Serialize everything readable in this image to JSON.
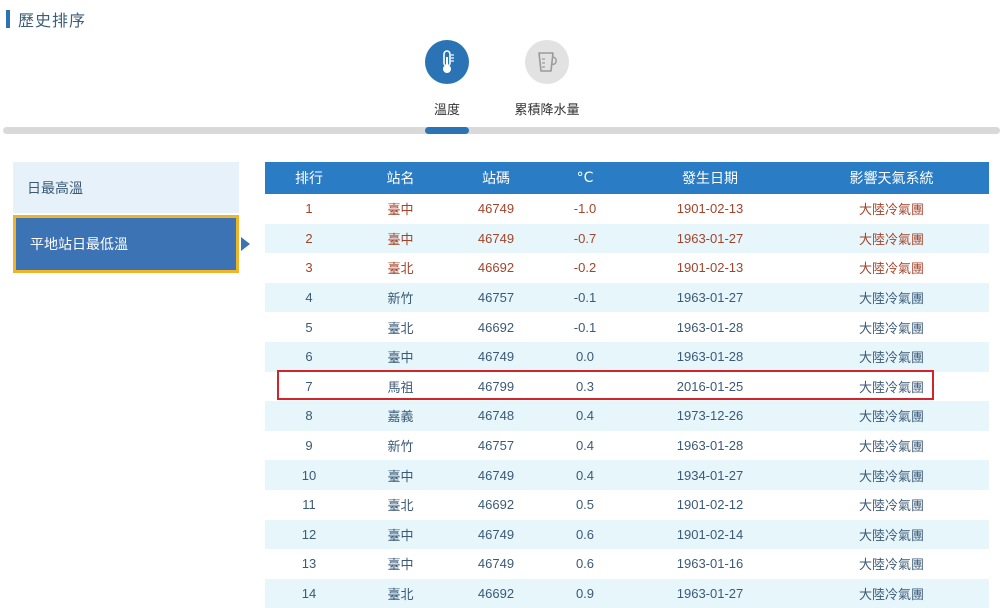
{
  "page": {
    "title": "歷史排序"
  },
  "tabs": [
    {
      "label": "溫度",
      "icon": "thermometer-icon",
      "active": true
    },
    {
      "label": "累積降水量",
      "icon": "rain-gauge-icon",
      "active": false
    }
  ],
  "sidebar": {
    "items": [
      {
        "label": "日最高溫",
        "active": false
      },
      {
        "label": "平地站日最低溫",
        "active": true
      }
    ]
  },
  "table": {
    "headers": [
      "排行",
      "站名",
      "站碼",
      "°C",
      "發生日期",
      "影響天氣系統"
    ],
    "rows": [
      [
        "1",
        "臺中",
        "46749",
        "-1.0",
        "1901-02-13",
        "大陸冷氣團"
      ],
      [
        "2",
        "臺中",
        "46749",
        "-0.7",
        "1963-01-27",
        "大陸冷氣團"
      ],
      [
        "3",
        "臺北",
        "46692",
        "-0.2",
        "1901-02-13",
        "大陸冷氣團"
      ],
      [
        "4",
        "新竹",
        "46757",
        "-0.1",
        "1963-01-27",
        "大陸冷氣團"
      ],
      [
        "5",
        "臺北",
        "46692",
        "-0.1",
        "1963-01-28",
        "大陸冷氣團"
      ],
      [
        "6",
        "臺中",
        "46749",
        "0.0",
        "1963-01-28",
        "大陸冷氣團"
      ],
      [
        "7",
        "馬祖",
        "46799",
        "0.3",
        "2016-01-25",
        "大陸冷氣團"
      ],
      [
        "8",
        "嘉義",
        "46748",
        "0.4",
        "1973-12-26",
        "大陸冷氣團"
      ],
      [
        "9",
        "新竹",
        "46757",
        "0.4",
        "1963-01-28",
        "大陸冷氣團"
      ],
      [
        "10",
        "臺中",
        "46749",
        "0.4",
        "1934-01-27",
        "大陸冷氣團"
      ],
      [
        "11",
        "臺北",
        "46692",
        "0.5",
        "1901-02-12",
        "大陸冷氣團"
      ],
      [
        "12",
        "臺中",
        "46749",
        "0.6",
        "1901-02-14",
        "大陸冷氣團"
      ],
      [
        "13",
        "臺中",
        "46749",
        "0.6",
        "1963-01-16",
        "大陸冷氣團"
      ],
      [
        "14",
        "臺北",
        "46692",
        "0.9",
        "1963-01-27",
        "大陸冷氣團"
      ]
    ],
    "top_rank_count": 3,
    "highlighted_rank": "7"
  },
  "colors": {
    "accent": "#2a74b6",
    "header_bg": "#2a7cc4",
    "top_rank_text": "#a4432a",
    "highlight_border": "#d0252c",
    "active_border": "#f0b429"
  }
}
